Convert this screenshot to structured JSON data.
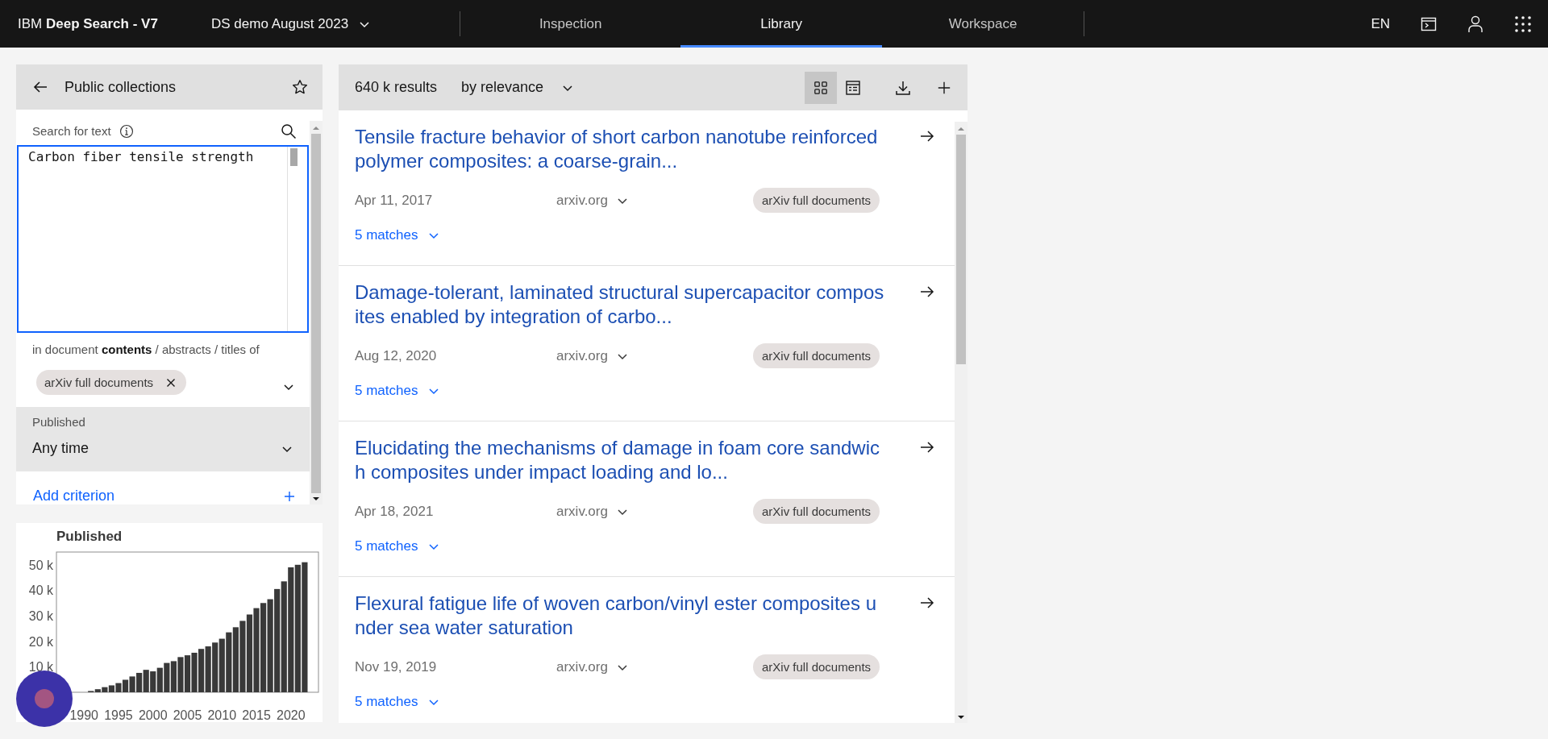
{
  "header": {
    "brand": "IBM **Deep Search - V7**",
    "project": "DS demo August 2023",
    "tabs": [
      {
        "label": "Inspection",
        "selected": false
      },
      {
        "label": "Library",
        "selected": true
      },
      {
        "label": "Workspace",
        "selected": false
      }
    ],
    "language": "EN"
  },
  "collections_panel": {
    "title": "Public collections",
    "search": {
      "label": "Search for text",
      "value": "Carbon fiber tensile strength"
    },
    "scope": "in document **contents** / abstracts / titles of",
    "collection_chip": "arXiv full documents",
    "published_filter": {
      "label": "Published",
      "value": "Any time"
    },
    "add_criterion": "Add criterion"
  },
  "published_chart": {
    "chart_data": {
      "type": "bar",
      "title": "Published",
      "x": [
        1991,
        1992,
        1993,
        1994,
        1995,
        1996,
        1997,
        1998,
        1999,
        2000,
        2001,
        2002,
        2003,
        2004,
        2005,
        2006,
        2007,
        2008,
        2009,
        2010,
        2011,
        2012,
        2013,
        2014,
        2015,
        2016,
        2017,
        2018,
        2019,
        2020,
        2021,
        2022
      ],
      "values": [
        500,
        1200,
        2000,
        2700,
        3600,
        4900,
        6200,
        7600,
        8800,
        8200,
        9600,
        11500,
        12200,
        13800,
        14500,
        15500,
        17000,
        18000,
        19500,
        21000,
        23500,
        25500,
        28000,
        30500,
        33000,
        35000,
        36500,
        40500,
        43500,
        49000,
        50000,
        51000
      ],
      "xlim": [
        1986,
        2024
      ],
      "ylim": [
        0,
        55000
      ],
      "xticks": [
        1990,
        1995,
        2000,
        2005,
        2010,
        2015,
        2020
      ],
      "yticks": [
        {
          "value": 10000,
          "label": "10 k"
        },
        {
          "value": 20000,
          "label": "20 k"
        },
        {
          "value": 30000,
          "label": "30 k"
        },
        {
          "value": 40000,
          "label": "40 k"
        },
        {
          "value": 50000,
          "label": "50 k"
        }
      ]
    }
  },
  "results": {
    "count": "640 k results",
    "sort": "by relevance",
    "views": [
      {
        "kind": "grid",
        "selected": true
      },
      {
        "kind": "table",
        "selected": false
      }
    ],
    "items": [
      {
        "title": "Tensile fracture behavior of short carbon nanotube reinforced polymer composites: a coarse-grain...",
        "date": "Apr 11, 2017",
        "source": "arxiv.org",
        "tag": "arXiv full documents",
        "matches": "5 matches"
      },
      {
        "title": "Damage-tolerant, laminated structural supercapacitor composites enabled by integration of carbo...",
        "date": "Aug 12, 2020",
        "source": "arxiv.org",
        "tag": "arXiv full documents",
        "matches": "5 matches"
      },
      {
        "title": "Elucidating the mechanisms of damage in foam core sandwich composites under impact loading and lo...",
        "date": "Apr 18, 2021",
        "source": "arxiv.org",
        "tag": "arXiv full documents",
        "matches": "5 matches"
      },
      {
        "title": "Flexural fatigue life of woven carbon/vinyl ester composites under sea water saturation",
        "date": "Nov 19, 2019",
        "source": "arxiv.org",
        "tag": "arXiv full documents",
        "matches": "5 matches"
      }
    ]
  }
}
